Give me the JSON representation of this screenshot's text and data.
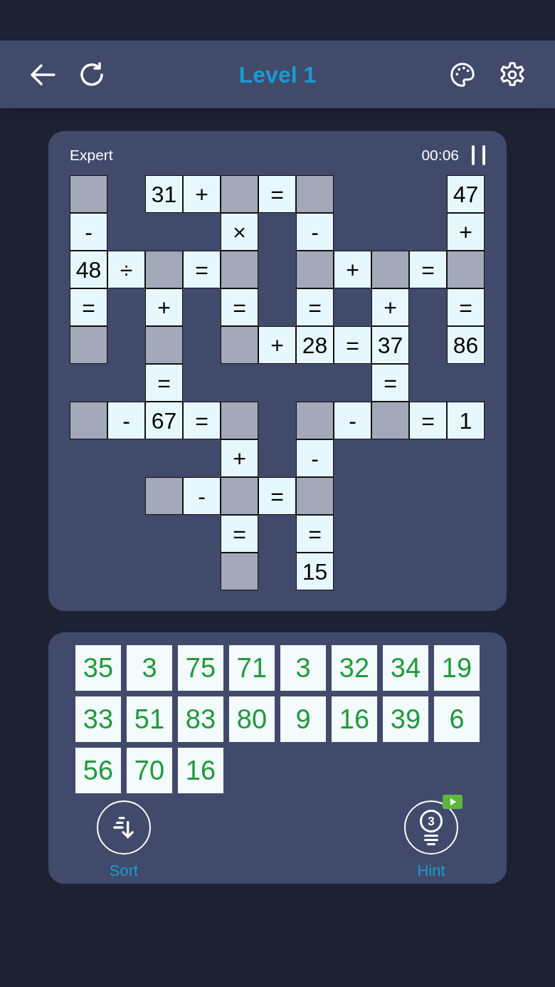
{
  "header": {
    "title": "Level 1"
  },
  "board": {
    "difficulty": "Expert",
    "timer": "00:06",
    "grid": [
      [
        {
          "kind": "empty"
        },
        {
          "kind": "gap"
        },
        {
          "kind": "given",
          "text": "31"
        },
        {
          "kind": "given",
          "text": "+"
        },
        {
          "kind": "empty"
        },
        {
          "kind": "given",
          "text": "="
        },
        {
          "kind": "empty"
        },
        {
          "kind": "gap"
        },
        {
          "kind": "gap"
        },
        {
          "kind": "gap"
        },
        {
          "kind": "given",
          "text": "47"
        }
      ],
      [
        {
          "kind": "given",
          "text": "-"
        },
        {
          "kind": "gap"
        },
        {
          "kind": "gap"
        },
        {
          "kind": "gap"
        },
        {
          "kind": "given",
          "text": "×"
        },
        {
          "kind": "gap"
        },
        {
          "kind": "given",
          "text": "-"
        },
        {
          "kind": "gap"
        },
        {
          "kind": "gap"
        },
        {
          "kind": "gap"
        },
        {
          "kind": "given",
          "text": "+"
        }
      ],
      [
        {
          "kind": "given",
          "text": "48"
        },
        {
          "kind": "given",
          "text": "÷"
        },
        {
          "kind": "empty"
        },
        {
          "kind": "given",
          "text": "="
        },
        {
          "kind": "empty"
        },
        {
          "kind": "gap"
        },
        {
          "kind": "empty"
        },
        {
          "kind": "given",
          "text": "+"
        },
        {
          "kind": "empty"
        },
        {
          "kind": "given",
          "text": "="
        },
        {
          "kind": "empty"
        }
      ],
      [
        {
          "kind": "given",
          "text": "="
        },
        {
          "kind": "gap"
        },
        {
          "kind": "given",
          "text": "+"
        },
        {
          "kind": "gap"
        },
        {
          "kind": "given",
          "text": "="
        },
        {
          "kind": "gap"
        },
        {
          "kind": "given",
          "text": "="
        },
        {
          "kind": "gap"
        },
        {
          "kind": "given",
          "text": "+"
        },
        {
          "kind": "gap"
        },
        {
          "kind": "given",
          "text": "="
        }
      ],
      [
        {
          "kind": "empty"
        },
        {
          "kind": "gap"
        },
        {
          "kind": "empty"
        },
        {
          "kind": "gap"
        },
        {
          "kind": "empty"
        },
        {
          "kind": "given",
          "text": "+"
        },
        {
          "kind": "given",
          "text": "28"
        },
        {
          "kind": "given",
          "text": "="
        },
        {
          "kind": "given",
          "text": "37"
        },
        {
          "kind": "gap"
        },
        {
          "kind": "given",
          "text": "86"
        }
      ],
      [
        {
          "kind": "gap"
        },
        {
          "kind": "gap"
        },
        {
          "kind": "given",
          "text": "="
        },
        {
          "kind": "gap"
        },
        {
          "kind": "gap"
        },
        {
          "kind": "gap"
        },
        {
          "kind": "gap"
        },
        {
          "kind": "gap"
        },
        {
          "kind": "given",
          "text": "="
        },
        {
          "kind": "gap"
        },
        {
          "kind": "gap"
        }
      ],
      [
        {
          "kind": "empty"
        },
        {
          "kind": "given",
          "text": "-"
        },
        {
          "kind": "given",
          "text": "67"
        },
        {
          "kind": "given",
          "text": "="
        },
        {
          "kind": "empty"
        },
        {
          "kind": "gap"
        },
        {
          "kind": "empty"
        },
        {
          "kind": "given",
          "text": "-"
        },
        {
          "kind": "empty"
        },
        {
          "kind": "given",
          "text": "="
        },
        {
          "kind": "given",
          "text": "1"
        }
      ],
      [
        {
          "kind": "gap"
        },
        {
          "kind": "gap"
        },
        {
          "kind": "gap"
        },
        {
          "kind": "gap"
        },
        {
          "kind": "given",
          "text": "+"
        },
        {
          "kind": "gap"
        },
        {
          "kind": "given",
          "text": "-"
        },
        {
          "kind": "gap"
        },
        {
          "kind": "gap"
        },
        {
          "kind": "gap"
        },
        {
          "kind": "gap"
        }
      ],
      [
        {
          "kind": "gap"
        },
        {
          "kind": "gap"
        },
        {
          "kind": "empty"
        },
        {
          "kind": "given",
          "text": "-"
        },
        {
          "kind": "empty"
        },
        {
          "kind": "given",
          "text": "="
        },
        {
          "kind": "empty"
        },
        {
          "kind": "gap"
        },
        {
          "kind": "gap"
        },
        {
          "kind": "gap"
        },
        {
          "kind": "gap"
        }
      ],
      [
        {
          "kind": "gap"
        },
        {
          "kind": "gap"
        },
        {
          "kind": "gap"
        },
        {
          "kind": "gap"
        },
        {
          "kind": "given",
          "text": "="
        },
        {
          "kind": "gap"
        },
        {
          "kind": "given",
          "text": "="
        },
        {
          "kind": "gap"
        },
        {
          "kind": "gap"
        },
        {
          "kind": "gap"
        },
        {
          "kind": "gap"
        }
      ],
      [
        {
          "kind": "gap"
        },
        {
          "kind": "gap"
        },
        {
          "kind": "gap"
        },
        {
          "kind": "gap"
        },
        {
          "kind": "empty"
        },
        {
          "kind": "gap"
        },
        {
          "kind": "given",
          "text": "15"
        },
        {
          "kind": "gap"
        },
        {
          "kind": "gap"
        },
        {
          "kind": "gap"
        },
        {
          "kind": "gap"
        }
      ]
    ]
  },
  "tiles": [
    "35",
    "3",
    "75",
    "71",
    "3",
    "32",
    "34",
    "19",
    "33",
    "51",
    "83",
    "80",
    "9",
    "16",
    "39",
    "6",
    "56",
    "70",
    "16"
  ],
  "actions": [
    {
      "kind": "sort",
      "label": "Sort"
    },
    {
      "kind": "hint",
      "label": "Hint",
      "badge": "3"
    }
  ]
}
